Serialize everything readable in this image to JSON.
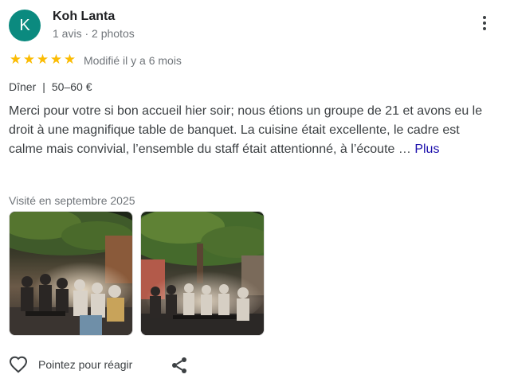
{
  "reviewer": {
    "initial": "K",
    "name": "Koh Lanta",
    "meta": "1 avis · 2 photos",
    "avatar_color": "#0b8a7f"
  },
  "rating": {
    "stars": 5,
    "max": 5,
    "star_color": "#fbbc04",
    "modified": "Modifié il y a 6 mois"
  },
  "attributes": {
    "meal": "Dîner",
    "separator": "|",
    "price": "50–60 €"
  },
  "review": {
    "text": "Merci pour votre si bon accueil hier soir; nous étions un groupe de 21 et avons eu le droit à une magnifique table de banquet. La cuisine était excellente, le cadre est calme mais convivial, l’ensemble du staff était attentionné, à l’écoute …",
    "more_label": "Plus"
  },
  "visited": "Visité en septembre 2025",
  "photos": [
    {
      "icon": "photo-dinner-group-night"
    },
    {
      "icon": "photo-dinner-group-tree"
    }
  ],
  "actions": {
    "react_label": "Pointez pour réagir",
    "react_icon": "heart-outline-icon",
    "share_icon": "share-icon",
    "more_icon": "more-vertical-icon"
  }
}
